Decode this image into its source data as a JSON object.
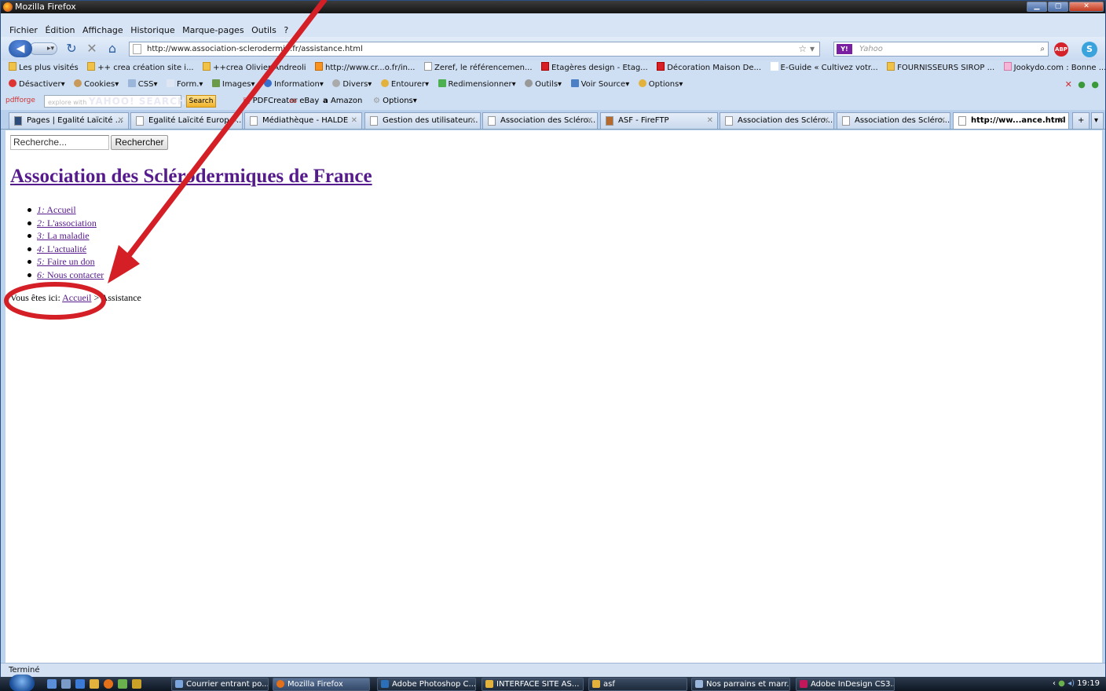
{
  "window": {
    "title": "Mozilla Firefox"
  },
  "menu": [
    "Fichier",
    "Édition",
    "Affichage",
    "Historique",
    "Marque-pages",
    "Outils",
    "?"
  ],
  "navigation": {
    "url": "http://www.association-sclerodermie.fr/assistance.html",
    "search_placeholder": "Yahoo"
  },
  "bookmarks": [
    "Les plus visités",
    "++ crea création site i...",
    "++crea Olivier Andreoli",
    "http://www.cr...o.fr/in...",
    "Zeref, le référencemen...",
    "Etagères design - Etag...",
    "Décoration Maison De...",
    "E-Guide « Cultivez votr...",
    "FOURNISSEURS SIROP ...",
    "Jookydo.com : Bonne ..."
  ],
  "dev_toolbar": [
    "Désactiver",
    "Cookies",
    "CSS",
    "Form.",
    "Images",
    "Information",
    "Divers",
    "Entourer",
    "Redimensionner",
    "Outils",
    "Voir Source",
    "Options"
  ],
  "pdf_toolbar": {
    "logo": "pdfforge",
    "search_hint": "explore with",
    "yahoo_brand": "YAHOO! SEARCH",
    "search_button": "Search",
    "items": [
      "PDFCreator",
      "eBay",
      "Amazon",
      "Options"
    ]
  },
  "tabs": [
    "Pages | Egalité Laïcité ...",
    "Egalité Laïcité Europe ...",
    "Médiathèque - HALDE",
    "Gestion des utilisateur...",
    "Association des Scléro...",
    "ASF - FireFTP",
    "Association des Scléro...",
    "Association des Scléro...",
    "http://ww...ance.html"
  ],
  "page": {
    "search_placeholder": "Recherche...",
    "search_button": "Rechercher",
    "site_title": "Association des Sclérodermiques de France",
    "menu": [
      {
        "num": "1:",
        "label": "Accueil"
      },
      {
        "num": "2:",
        "label": "L'association"
      },
      {
        "num": "3:",
        "label": "La maladie"
      },
      {
        "num": "4:",
        "label": "L'actualité"
      },
      {
        "num": "5:",
        "label": "Faire un don"
      },
      {
        "num": "6:",
        "label": "Nous contacter"
      }
    ],
    "breadcrumb": {
      "prefix": "Vous êtes ici:",
      "home": "Accueil",
      "separator": ">",
      "current": "Assistance"
    }
  },
  "annotation": {
    "color": "#d41f26"
  },
  "status": "Terminé",
  "taskbar": {
    "windows": [
      "Courrier entrant po...",
      "Mozilla Firefox",
      "Adobe Photoshop C...",
      "INTERFACE SITE AS...",
      "asf",
      "Nos parrains et marr...",
      "Adobe InDesign CS3..."
    ],
    "clock": "19:19"
  }
}
